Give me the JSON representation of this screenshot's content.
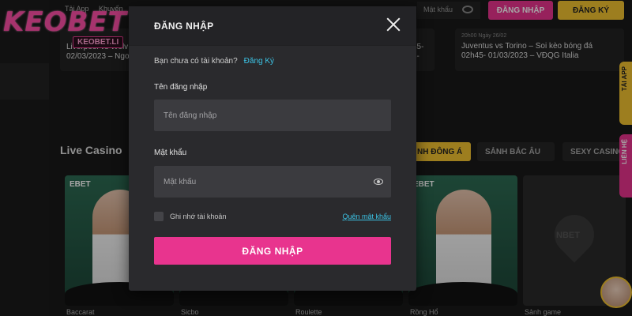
{
  "background": {
    "logo": "KEOBET",
    "logo_domain": "KEOBET.LI",
    "top_tabs": [
      "Tải App",
      "Khuyến"
    ],
    "news": [
      {
        "date": "",
        "title": "Liverpool vs Wolv 02/03/2023 – Ngo"
      },
      {
        "date": "20h00 Ngày 26/02",
        "title": "Juventus vs Torino – Soi kèo bóng đá 02h45- 01/03/2023 – VĐQG Italia"
      }
    ],
    "news_mid_fragment": "45- 3-",
    "header_search": "Mật khẩu",
    "btn_login": "ĐĂNG NHẬP",
    "btn_register": "ĐĂNG KÝ",
    "live_title": "Live Casino",
    "chips": [
      "NH ĐÔNG Á",
      "SẢNH BẮC ÂU",
      "SEXY CASINO"
    ],
    "game_brand": "EBET",
    "game_names": [
      "Baccarat",
      "Sicbo",
      "Roulette",
      "Rồng Hổ",
      "Sảnh game"
    ],
    "placeholder_brand": "NBET",
    "side_tabs": [
      "TẢI APP",
      "LIÊN HỆ"
    ]
  },
  "modal": {
    "title": "ĐĂNG NHẬP",
    "no_account_text": "Bạn chưa có tài khoản?",
    "register_link": "Đăng Ký",
    "username_label": "Tên đăng nhập",
    "username_placeholder": "Tên đăng nhập",
    "password_label": "Mật khẩu",
    "password_placeholder": "Mật khẩu",
    "remember_label": "Ghi nhớ tài khoản",
    "forgot_link": "Quên mật khẩu",
    "submit_label": "ĐĂNG NHẬP"
  },
  "colors": {
    "accent_pink": "#e8348e",
    "accent_yellow": "#f2c230",
    "link_cyan": "#3cc4e6",
    "modal_bg": "#2a2a2d"
  },
  "icons": {
    "close": "close-icon",
    "password_toggle": "eye-icon"
  }
}
